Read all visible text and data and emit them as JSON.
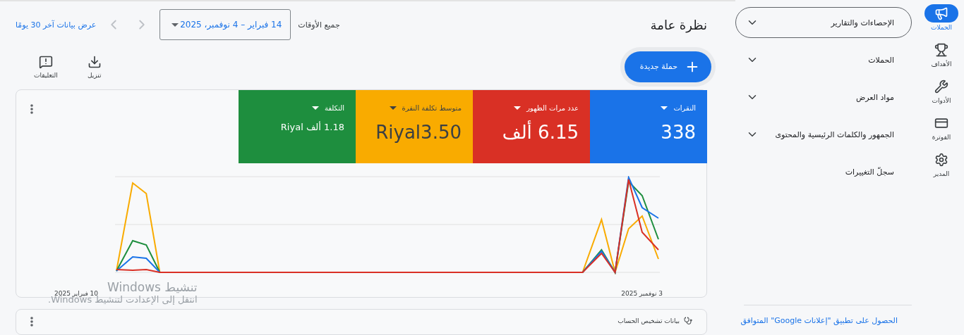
{
  "rail": [
    {
      "label": "الحملات",
      "selected": true
    },
    {
      "label": "الأهداف",
      "selected": false
    },
    {
      "label": "الأدوات",
      "selected": false
    },
    {
      "label": "الفوترة",
      "selected": false
    },
    {
      "label": "المدير",
      "selected": false
    }
  ],
  "nav": [
    {
      "label": "الإحصاءات والتقارير",
      "expandable": true,
      "selected": true
    },
    {
      "label": "الحملات",
      "expandable": true,
      "selected": false
    },
    {
      "label": "مواد العرض",
      "expandable": true,
      "selected": false
    },
    {
      "label": "الجمهور والكلمات الرئيسية والمحتوى",
      "expandable": true,
      "selected": false
    },
    {
      "label": "سجلّ التغييرات",
      "expandable": false,
      "selected": false
    }
  ],
  "app_link": "الحصول على تطبيق \"إعلانات Google\" المتوافق",
  "title": "نظرة عامة",
  "date_range": {
    "label": "جميع الأوقات",
    "value": "14 فبراير – 4 نوفمبر، 2025"
  },
  "last_30_link": "عرض بيانات آخر 30 يومًا",
  "new_campaign": "حملة جديدة",
  "actions": [
    {
      "label": "تنزيل"
    },
    {
      "label": "التعليقات"
    }
  ],
  "metrics": [
    {
      "label": "النقرات",
      "value": "338",
      "color": "#1a73e8"
    },
    {
      "label": "عدد مرات الظهور",
      "value": "6.15 ألف",
      "color": "#d93025"
    },
    {
      "label": "متوسط تكلفة النقرة",
      "value": "Riyal3.50",
      "color": "#f9ab00"
    },
    {
      "label": "التكلفة",
      "value": "1.18 ألف Riyal",
      "color": "#1e8e3e"
    }
  ],
  "chart_x_labels": [
    "3 نوفمبر 2025",
    "10 فبراير 2025"
  ],
  "next_card": {
    "title": "بيانات تشخيص الحساب"
  },
  "os_notice": {
    "title": "تنشيط Windows",
    "text": "انتقل إلى الإعدادت لتنشيط Windows."
  }
}
